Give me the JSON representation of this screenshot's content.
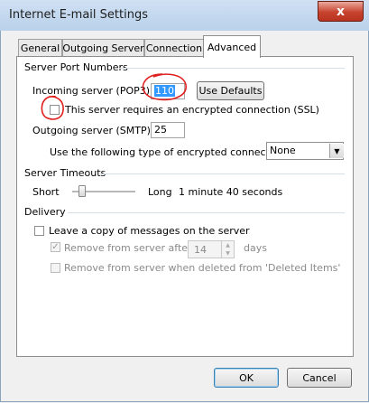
{
  "window": {
    "title": "Internet E-mail Settings",
    "close_glyph": "x"
  },
  "tabs": [
    {
      "label": "General",
      "active": false
    },
    {
      "label": "Outgoing Server",
      "active": false
    },
    {
      "label": "Connection",
      "active": false
    },
    {
      "label": "Advanced",
      "active": true
    }
  ],
  "server_ports": {
    "group_label": "Server Port Numbers",
    "incoming_label": "Incoming server (POP3):",
    "incoming_value": "110",
    "use_defaults_label": "Use Defaults",
    "ssl_label": "This server requires an encrypted connection (SSL)",
    "ssl_checked": false,
    "outgoing_label": "Outgoing server (SMTP):",
    "outgoing_value": "25",
    "encryption_label": "Use the following type of encrypted connection:",
    "encryption_value": "None"
  },
  "timeouts": {
    "group_label": "Server Timeouts",
    "short_label": "Short",
    "long_label": "Long",
    "value_text": "1 minute 40 seconds"
  },
  "delivery": {
    "group_label": "Delivery",
    "leave_copy_label": "Leave a copy of messages on the server",
    "leave_copy_checked": false,
    "remove_after_label": "Remove from server after",
    "remove_after_checked": true,
    "remove_after_days": "14",
    "days_label": "days",
    "remove_deleted_label": "Remove from server when deleted from 'Deleted Items'",
    "remove_deleted_checked": false
  },
  "footer": {
    "ok_label": "OK",
    "cancel_label": "Cancel"
  },
  "colors": {
    "annotation_circle": "#e0201e",
    "selection": "#3399ff"
  }
}
